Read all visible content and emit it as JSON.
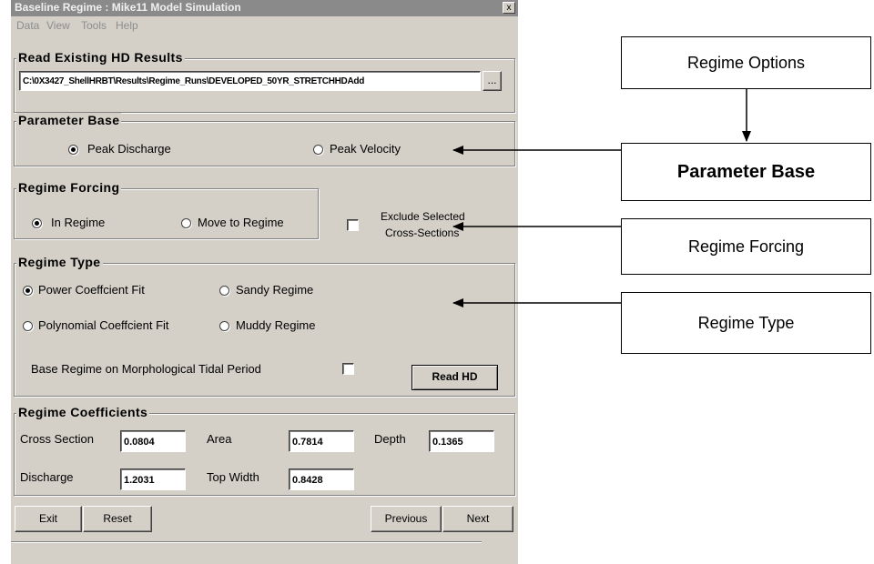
{
  "window": {
    "title": "Baseline Regime  :  Mike11 Model Simulation",
    "close_glyph": "x"
  },
  "menu": [
    "Data",
    "View",
    "Tools",
    "Help"
  ],
  "read_hd": {
    "group_title": "Read Existing HD Results",
    "path_value": "C:\\0X3427_ShellHRBT\\Results\\Regime_Runs\\DEVELOPED_50YR_STRETCHHDAdd",
    "browse_label": "..."
  },
  "parameter_base": {
    "group_title": "Parameter Base",
    "options": [
      {
        "label": "Peak Discharge",
        "selected": true
      },
      {
        "label": "Peak Velocity",
        "selected": false
      }
    ]
  },
  "regime_forcing": {
    "group_title": "Regime Forcing",
    "options": [
      {
        "label": "In Regime",
        "selected": true
      },
      {
        "label": "Move to Regime",
        "selected": false
      }
    ],
    "exclude_label_1": "Exclude Selected",
    "exclude_label_2": "Cross-Sections",
    "exclude_checked": false
  },
  "regime_type": {
    "group_title": "Regime Type",
    "options": [
      {
        "label": "Power Coeffcient Fit",
        "selected": true
      },
      {
        "label": "Sandy Regime",
        "selected": false
      },
      {
        "label": "Polynomial Coeffcient Fit",
        "selected": false
      },
      {
        "label": "Muddy Regime",
        "selected": false
      }
    ],
    "tidal_label": "Base Regime on Morphological Tidal Period",
    "tidal_checked": false,
    "read_hd_button": "Read HD"
  },
  "regime_coefficients": {
    "group_title": "Regime Coefficients",
    "cross_section_label": "Cross Section",
    "cross_section_value": "0.0804",
    "area_label": "Area",
    "area_value": "0.7814",
    "depth_label": "Depth",
    "depth_value": "0.1365",
    "discharge_label": "Discharge",
    "discharge_value": "1.2031",
    "top_width_label": "Top Width",
    "top_width_value": "0.8428"
  },
  "buttons": {
    "exit": "Exit",
    "reset": "Reset",
    "previous": "Previous",
    "next": "Next"
  },
  "diagram": {
    "regime_options": "Regime Options",
    "parameter_base": "Parameter Base",
    "regime_forcing": "Regime Forcing",
    "regime_type": "Regime Type"
  },
  "colors": {
    "window_bg": "#d4d0c8",
    "titlebar": "#8a8a8a",
    "menu_text": "#8c8c8c"
  }
}
